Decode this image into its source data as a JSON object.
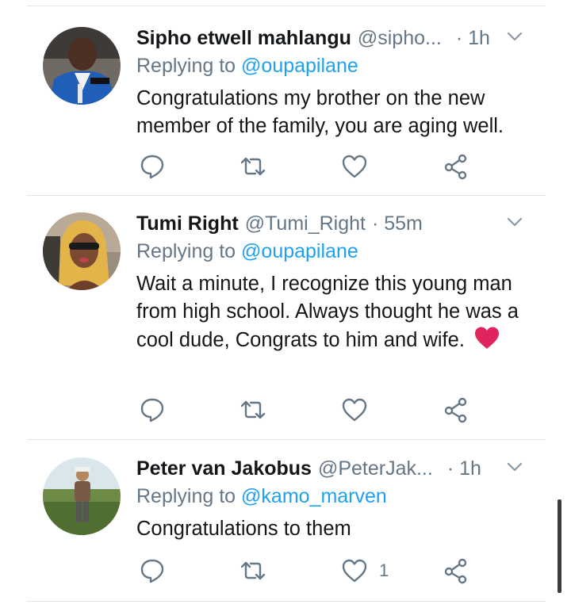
{
  "tweets": [
    {
      "name": "Sipho etwell mahlangu",
      "handle": "@sipho...",
      "time": "· 1h",
      "replying_prefix": "Replying to",
      "replying_to": "@oupapilane",
      "text": "Congratulations my brother on the new member of the family, you are aging well.",
      "likes": ""
    },
    {
      "name": "Tumi Right",
      "handle": "@Tumi_Right",
      "time": "· 55m",
      "replying_prefix": "Replying to",
      "replying_to": "@oupapilane",
      "text": "Wait a minute, I recognize this young man from high school. Always thought he was a cool dude, Congrats to him and wife.",
      "emoji": "red-heart",
      "likes": ""
    },
    {
      "name": "Peter van Jakobus",
      "handle": "@PeterJak...",
      "time": "· 1h",
      "replying_prefix": "Replying to",
      "replying_to": "@kamo_marven",
      "text": "Congratulations to them",
      "likes": "1"
    }
  ],
  "icons": {
    "reply": "reply-icon",
    "retweet": "retweet-icon",
    "like": "like-icon",
    "share": "share-icon",
    "caret": "chevron-down-icon"
  },
  "colors": {
    "text": "#14171a",
    "secondary": "#657786",
    "link": "#1da1f2",
    "divider": "#e3e6e9",
    "heart": "#e0245e"
  }
}
